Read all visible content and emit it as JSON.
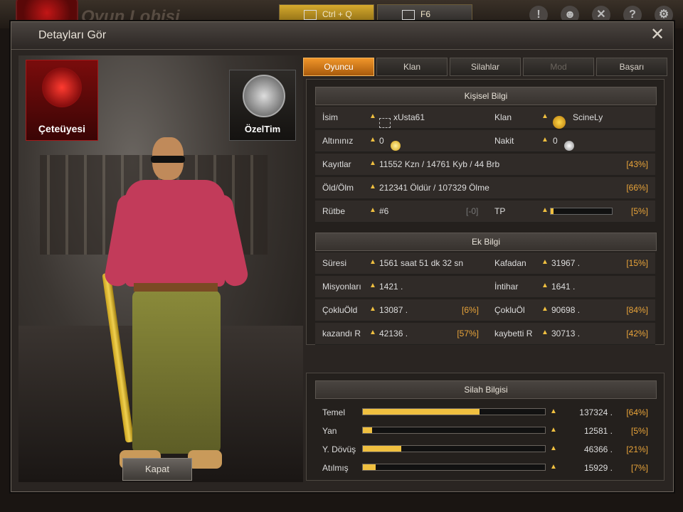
{
  "lobby": {
    "title": "Oyun Lobisi",
    "hotkeys": [
      "Ctrl + Q",
      "F6"
    ],
    "icons": [
      "alert-icon",
      "friends-icon",
      "close-circle-icon",
      "help-icon",
      "settings-icon"
    ]
  },
  "dialog": {
    "title": "Detayları Gör",
    "close": "✕",
    "close_button": "Kapat",
    "badges": {
      "gang": "Çeteüyesi",
      "elite": "ÖzelTim"
    },
    "tabs": [
      {
        "label": "Oyuncu",
        "state": "active"
      },
      {
        "label": "Klan",
        "state": "normal"
      },
      {
        "label": "Silahlar",
        "state": "normal"
      },
      {
        "label": "Mod",
        "state": "disabled"
      },
      {
        "label": "Başarı",
        "state": "normal"
      }
    ],
    "personal": {
      "header": "Kişisel Bilgi",
      "name_label": "İsim",
      "name_value": "xUsta61",
      "clan_label": "Klan",
      "clan_value": "ScineLy",
      "gold_label": "Altınınız",
      "gold_value": "0",
      "cash_label": "Nakit",
      "cash_value": "0",
      "records_label": "Kayıtlar",
      "records_value": "11552 Kzn / 14761 Kyb / 44 Brb",
      "records_pct": "[43%]",
      "kd_label": "Öld/Ölm",
      "kd_value": "212341 Öldür / 107329 Ölme",
      "kd_pct": "[66%]",
      "rank_label": "Rütbe",
      "rank_value": "#6",
      "rank_change": "[-0]",
      "tp_label": "TP",
      "tp_pct": "[5%]",
      "tp_progress": 0.05
    },
    "extra": {
      "header": "Ek Bilgi",
      "rows": [
        {
          "l1": "Süresi",
          "v1": "1561 saat 51 dk 32 sn",
          "p1": "",
          "l2": "Kafadan",
          "v2": "31967 .",
          "p2": "[15%]"
        },
        {
          "l1": "Misyonları",
          "v1": "1421 .",
          "p1": "",
          "l2": "İntihar",
          "v2": "1641 .",
          "p2": ""
        },
        {
          "l1": "ÇokluÖld",
          "v1": "13087 .",
          "p1": "[6%]",
          "l2": "ÇokluÖl",
          "v2": "90698 .",
          "p2": "[84%]"
        },
        {
          "l1": "kazandı R",
          "v1": "42136 .",
          "p1": "[57%]",
          "l2": "kaybetti R",
          "v2": "30713 .",
          "p2": "[42%]"
        }
      ]
    },
    "weapons": {
      "header": "Silah Bilgisi",
      "rows": [
        {
          "label": "Temel",
          "value": "137324 .",
          "pct": "[64%]",
          "progress": 0.64
        },
        {
          "label": "Yan",
          "value": "12581 .",
          "pct": "[5%]",
          "progress": 0.05
        },
        {
          "label": "Y. Dövüş",
          "value": "46366 .",
          "pct": "[21%]",
          "progress": 0.21
        },
        {
          "label": "Atılmış",
          "value": "15929 .",
          "pct": "[7%]",
          "progress": 0.07
        }
      ]
    }
  }
}
